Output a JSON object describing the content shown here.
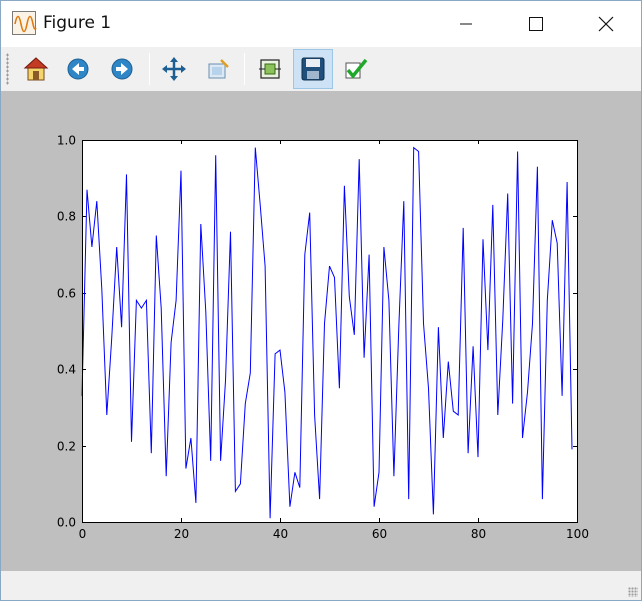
{
  "window": {
    "title": "Figure 1"
  },
  "toolbar": {
    "buttons": [
      {
        "icon": "home-icon"
      },
      {
        "icon": "back-arrow-icon"
      },
      {
        "icon": "forward-arrow-icon"
      },
      {
        "icon": "pan-move-icon"
      },
      {
        "icon": "zoom-rect-icon"
      },
      {
        "icon": "subplots-config-icon"
      },
      {
        "icon": "save-floppy-icon"
      },
      {
        "icon": "edit-check-icon"
      }
    ]
  },
  "colors": {
    "line": "#0000ff",
    "canvas_bg": "#bfbfbf",
    "plot_bg": "#ffffff"
  },
  "chart_data": {
    "type": "line",
    "title": "",
    "xlabel": "",
    "ylabel": "",
    "xlim": [
      0,
      100
    ],
    "ylim": [
      0,
      1
    ],
    "xticks": [
      "0",
      "20",
      "40",
      "60",
      "80",
      "100"
    ],
    "yticks": [
      "0.0",
      "0.2",
      "0.4",
      "0.6",
      "0.8",
      "1.0"
    ],
    "grid": false,
    "series": [
      {
        "x": [
          0,
          1,
          2,
          3,
          4,
          5,
          6,
          7,
          8,
          9,
          10,
          11,
          12,
          13,
          14,
          15,
          16,
          17,
          18,
          19,
          20,
          21,
          22,
          23,
          24,
          25,
          26,
          27,
          28,
          29,
          30,
          31,
          32,
          33,
          34,
          35,
          36,
          37,
          38,
          39,
          40,
          41,
          42,
          43,
          44,
          45,
          46,
          47,
          48,
          49,
          50,
          51,
          52,
          53,
          54,
          55,
          56,
          57,
          58,
          59,
          60,
          61,
          62,
          63,
          64,
          65,
          66,
          67,
          68,
          69,
          70,
          71,
          72,
          73,
          74,
          75,
          76,
          77,
          78,
          79,
          80,
          81,
          82,
          83,
          84,
          85,
          86,
          87,
          88,
          89,
          90,
          91,
          92,
          93,
          94,
          95,
          96,
          97,
          98,
          99
        ],
        "y": [
          0.33,
          0.87,
          0.72,
          0.84,
          0.61,
          0.28,
          0.48,
          0.72,
          0.51,
          0.91,
          0.21,
          0.58,
          0.56,
          0.58,
          0.18,
          0.75,
          0.56,
          0.12,
          0.47,
          0.58,
          0.92,
          0.14,
          0.22,
          0.05,
          0.78,
          0.55,
          0.16,
          0.96,
          0.16,
          0.37,
          0.76,
          0.08,
          0.1,
          0.31,
          0.39,
          0.98,
          0.83,
          0.67,
          0.01,
          0.44,
          0.45,
          0.34,
          0.04,
          0.13,
          0.09,
          0.7,
          0.81,
          0.28,
          0.06,
          0.52,
          0.67,
          0.64,
          0.35,
          0.88,
          0.59,
          0.49,
          0.95,
          0.43,
          0.7,
          0.04,
          0.13,
          0.72,
          0.58,
          0.12,
          0.51,
          0.84,
          0.06,
          0.98,
          0.97,
          0.52,
          0.35,
          0.02,
          0.51,
          0.22,
          0.42,
          0.29,
          0.28,
          0.77,
          0.18,
          0.46,
          0.17,
          0.74,
          0.45,
          0.83,
          0.28,
          0.53,
          0.86,
          0.31,
          0.97,
          0.22,
          0.34,
          0.52,
          0.93,
          0.06,
          0.58,
          0.79,
          0.73,
          0.33,
          0.89,
          0.19
        ]
      }
    ]
  }
}
